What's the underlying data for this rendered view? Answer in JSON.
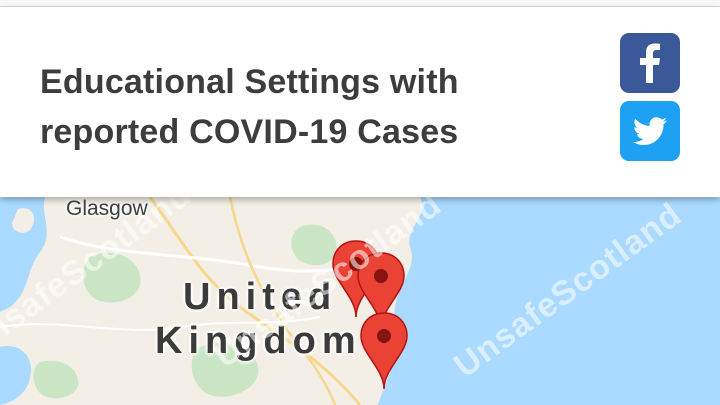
{
  "header": {
    "title_line1": "Educational Settings with",
    "title_line2": "reported COVID-19 Cases"
  },
  "share": {
    "facebook_icon": "facebook-icon",
    "twitter_icon": "twitter-icon",
    "facebook_color": "#3b5998",
    "twitter_color": "#1da1f2"
  },
  "map": {
    "city_label": "Glasgow",
    "country_line1": "United",
    "country_line2": "Kingdom",
    "marker_icon": "map-pin-icon",
    "marker_color": "#ea4335",
    "water_color": "#aadaff",
    "land_color": "#f3efe6",
    "watermark_text": "UnsafeScotland"
  }
}
